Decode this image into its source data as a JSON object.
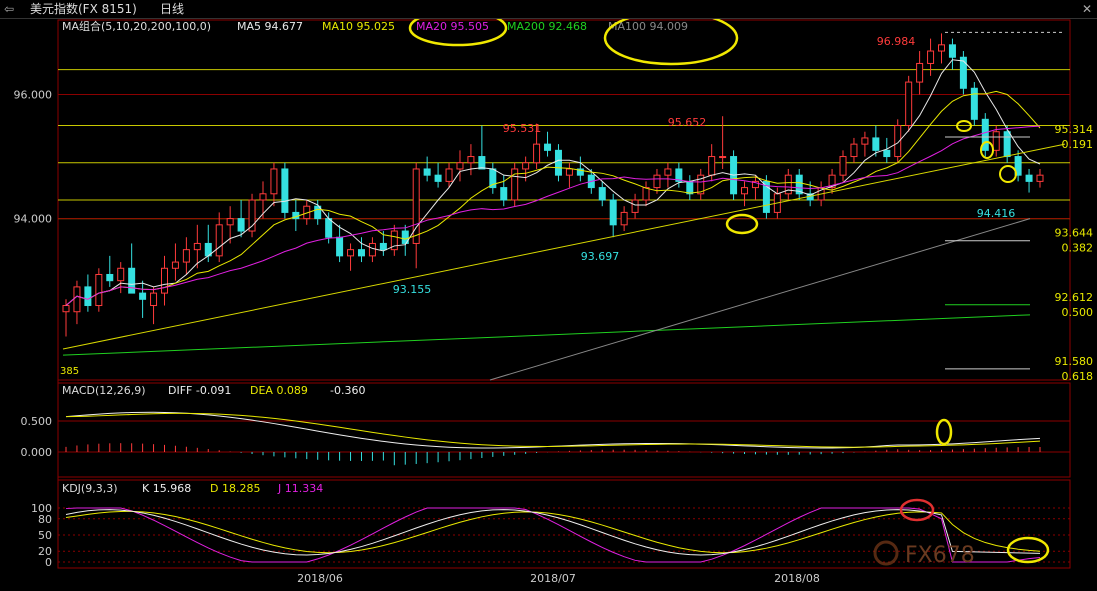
{
  "header": {
    "symbol_title": "美元指数(FX 8151)",
    "period": "日线"
  },
  "colors": {
    "up": "#ff3b3b",
    "down": "#35e0e0",
    "ma5": "#e8e8e8",
    "ma10": "#e8e800",
    "ma20": "#e020e0",
    "ma200": "#20d020",
    "ma100": "#888888",
    "grid": "#8b0000",
    "fib": "#e8e800"
  },
  "main_panel": {
    "legend": {
      "ma_group": "MA组合(5,10,20,200,100,0)",
      "ma5": "MA5 94.677",
      "ma10": "MA10 95.025",
      "ma20": "MA20 95.505",
      "ma200": "MA200 92.468",
      "ma100": "MA100 94.009"
    },
    "y_ticks": [
      "96.000",
      "94.000"
    ],
    "annotations": {
      "high": "96.984",
      "peak1": "95.531",
      "peak2": "95.652",
      "low1": "93.155",
      "low2": "93.697",
      "recent_low": "94.416",
      "corner_label": "385"
    },
    "fib_levels": [
      {
        "price": "95.314",
        "ratio": "0.191"
      },
      {
        "price": "93.644",
        "ratio": "0.382"
      },
      {
        "price": "92.612",
        "ratio": "0.500"
      },
      {
        "price": "91.580",
        "ratio": "0.618"
      }
    ]
  },
  "macd_panel": {
    "title": "MACD(12,26,9)",
    "diff": "DIFF -0.091",
    "dea": "DEA 0.089",
    "macd": "-0.360",
    "y_ticks": [
      "0.500",
      "0.000"
    ]
  },
  "kdj_panel": {
    "title": "KDJ(9,3,3)",
    "k": "K 15.968",
    "d": "D 18.285",
    "j": "J 11.334",
    "y_ticks": [
      "100",
      "80",
      "50",
      "20",
      "0"
    ]
  },
  "x_axis": [
    "2018/06",
    "2018/07",
    "2018/08"
  ],
  "watermark": "FX678",
  "chart_data": {
    "type": "candlestick",
    "ylim": [
      91.4,
      97.2
    ],
    "candles": [
      {
        "o": 92.5,
        "h": 92.7,
        "l": 92.1,
        "c": 92.6
      },
      {
        "o": 92.5,
        "h": 93.0,
        "l": 92.3,
        "c": 92.9
      },
      {
        "o": 92.9,
        "h": 93.1,
        "l": 92.5,
        "c": 92.6
      },
      {
        "o": 92.6,
        "h": 93.2,
        "l": 92.5,
        "c": 93.1
      },
      {
        "o": 93.1,
        "h": 93.4,
        "l": 92.9,
        "c": 93.0
      },
      {
        "o": 93.0,
        "h": 93.3,
        "l": 92.8,
        "c": 93.2
      },
      {
        "o": 93.2,
        "h": 93.6,
        "l": 92.9,
        "c": 92.8
      },
      {
        "o": 92.8,
        "h": 93.0,
        "l": 92.4,
        "c": 92.7
      },
      {
        "o": 92.6,
        "h": 92.9,
        "l": 92.3,
        "c": 92.8
      },
      {
        "o": 92.8,
        "h": 93.4,
        "l": 92.6,
        "c": 93.2
      },
      {
        "o": 93.2,
        "h": 93.6,
        "l": 93.0,
        "c": 93.3
      },
      {
        "o": 93.3,
        "h": 93.7,
        "l": 93.1,
        "c": 93.5
      },
      {
        "o": 93.5,
        "h": 93.9,
        "l": 93.2,
        "c": 93.6
      },
      {
        "o": 93.6,
        "h": 93.9,
        "l": 93.3,
        "c": 93.4
      },
      {
        "o": 93.4,
        "h": 94.1,
        "l": 93.3,
        "c": 93.9
      },
      {
        "o": 93.9,
        "h": 94.2,
        "l": 93.6,
        "c": 94.0
      },
      {
        "o": 94.0,
        "h": 94.3,
        "l": 93.7,
        "c": 93.8
      },
      {
        "o": 93.8,
        "h": 94.4,
        "l": 93.7,
        "c": 94.3
      },
      {
        "o": 94.3,
        "h": 94.6,
        "l": 94.0,
        "c": 94.4
      },
      {
        "o": 94.4,
        "h": 94.9,
        "l": 94.2,
        "c": 94.8
      },
      {
        "o": 94.8,
        "h": 94.9,
        "l": 94.0,
        "c": 94.1
      },
      {
        "o": 94.1,
        "h": 94.3,
        "l": 93.8,
        "c": 94.0
      },
      {
        "o": 94.0,
        "h": 94.3,
        "l": 93.9,
        "c": 94.2
      },
      {
        "o": 94.2,
        "h": 94.3,
        "l": 93.9,
        "c": 94.0
      },
      {
        "o": 94.0,
        "h": 94.1,
        "l": 93.6,
        "c": 93.7
      },
      {
        "o": 93.7,
        "h": 93.9,
        "l": 93.3,
        "c": 93.4
      },
      {
        "o": 93.4,
        "h": 93.6,
        "l": 93.16,
        "c": 93.5
      },
      {
        "o": 93.5,
        "h": 93.7,
        "l": 93.3,
        "c": 93.4
      },
      {
        "o": 93.4,
        "h": 93.7,
        "l": 93.3,
        "c": 93.6
      },
      {
        "o": 93.6,
        "h": 93.8,
        "l": 93.4,
        "c": 93.5
      },
      {
        "o": 93.5,
        "h": 93.9,
        "l": 93.4,
        "c": 93.8
      },
      {
        "o": 93.8,
        "h": 93.9,
        "l": 93.4,
        "c": 93.6
      },
      {
        "o": 93.6,
        "h": 94.9,
        "l": 93.2,
        "c": 94.8
      },
      {
        "o": 94.8,
        "h": 95.0,
        "l": 94.6,
        "c": 94.7
      },
      {
        "o": 94.7,
        "h": 94.9,
        "l": 94.5,
        "c": 94.6
      },
      {
        "o": 94.6,
        "h": 94.9,
        "l": 94.5,
        "c": 94.8
      },
      {
        "o": 94.8,
        "h": 95.1,
        "l": 94.6,
        "c": 94.9
      },
      {
        "o": 94.9,
        "h": 95.2,
        "l": 94.7,
        "c": 95.0
      },
      {
        "o": 95.0,
        "h": 95.5,
        "l": 94.8,
        "c": 94.8
      },
      {
        "o": 94.8,
        "h": 94.9,
        "l": 94.4,
        "c": 94.5
      },
      {
        "o": 94.5,
        "h": 94.7,
        "l": 94.2,
        "c": 94.3
      },
      {
        "o": 94.3,
        "h": 94.9,
        "l": 94.2,
        "c": 94.8
      },
      {
        "o": 94.8,
        "h": 95.0,
        "l": 94.6,
        "c": 94.9
      },
      {
        "o": 94.9,
        "h": 95.53,
        "l": 94.8,
        "c": 95.2
      },
      {
        "o": 95.2,
        "h": 95.4,
        "l": 95.0,
        "c": 95.1
      },
      {
        "o": 95.1,
        "h": 95.2,
        "l": 94.6,
        "c": 94.7
      },
      {
        "o": 94.7,
        "h": 94.9,
        "l": 94.5,
        "c": 94.8
      },
      {
        "o": 94.8,
        "h": 95.0,
        "l": 94.6,
        "c": 94.7
      },
      {
        "o": 94.7,
        "h": 94.8,
        "l": 94.4,
        "c": 94.5
      },
      {
        "o": 94.5,
        "h": 94.6,
        "l": 94.2,
        "c": 94.3
      },
      {
        "o": 94.3,
        "h": 94.4,
        "l": 93.7,
        "c": 93.9
      },
      {
        "o": 93.9,
        "h": 94.2,
        "l": 93.8,
        "c": 94.1
      },
      {
        "o": 94.1,
        "h": 94.4,
        "l": 94.0,
        "c": 94.3
      },
      {
        "o": 94.3,
        "h": 94.6,
        "l": 94.2,
        "c": 94.5
      },
      {
        "o": 94.5,
        "h": 94.8,
        "l": 94.4,
        "c": 94.7
      },
      {
        "o": 94.7,
        "h": 94.9,
        "l": 94.5,
        "c": 94.8
      },
      {
        "o": 94.8,
        "h": 94.9,
        "l": 94.5,
        "c": 94.6
      },
      {
        "o": 94.6,
        "h": 94.7,
        "l": 94.3,
        "c": 94.4
      },
      {
        "o": 94.4,
        "h": 94.8,
        "l": 94.3,
        "c": 94.7
      },
      {
        "o": 94.7,
        "h": 95.2,
        "l": 94.6,
        "c": 95.0
      },
      {
        "o": 95.0,
        "h": 95.65,
        "l": 94.8,
        "c": 95.0
      },
      {
        "o": 95.0,
        "h": 95.1,
        "l": 94.3,
        "c": 94.4
      },
      {
        "o": 94.4,
        "h": 94.6,
        "l": 94.2,
        "c": 94.5
      },
      {
        "o": 94.5,
        "h": 94.7,
        "l": 94.3,
        "c": 94.6
      },
      {
        "o": 94.6,
        "h": 94.7,
        "l": 94.0,
        "c": 94.1
      },
      {
        "o": 94.1,
        "h": 94.5,
        "l": 94.0,
        "c": 94.4
      },
      {
        "o": 94.4,
        "h": 94.8,
        "l": 94.3,
        "c": 94.7
      },
      {
        "o": 94.7,
        "h": 94.8,
        "l": 94.3,
        "c": 94.4
      },
      {
        "o": 94.4,
        "h": 94.6,
        "l": 94.2,
        "c": 94.3
      },
      {
        "o": 94.3,
        "h": 94.6,
        "l": 94.2,
        "c": 94.5
      },
      {
        "o": 94.5,
        "h": 94.8,
        "l": 94.4,
        "c": 94.7
      },
      {
        "o": 94.7,
        "h": 95.1,
        "l": 94.6,
        "c": 95.0
      },
      {
        "o": 95.0,
        "h": 95.3,
        "l": 94.9,
        "c": 95.2
      },
      {
        "o": 95.2,
        "h": 95.4,
        "l": 95.0,
        "c": 95.3
      },
      {
        "o": 95.3,
        "h": 95.5,
        "l": 95.0,
        "c": 95.1
      },
      {
        "o": 95.1,
        "h": 95.3,
        "l": 94.9,
        "c": 95.0
      },
      {
        "o": 95.0,
        "h": 95.6,
        "l": 94.9,
        "c": 95.5
      },
      {
        "o": 95.5,
        "h": 96.3,
        "l": 95.4,
        "c": 96.2
      },
      {
        "o": 96.2,
        "h": 96.7,
        "l": 96.0,
        "c": 96.5
      },
      {
        "o": 96.5,
        "h": 96.9,
        "l": 96.3,
        "c": 96.7
      },
      {
        "o": 96.7,
        "h": 96.984,
        "l": 96.5,
        "c": 96.8
      },
      {
        "o": 96.8,
        "h": 96.9,
        "l": 96.4,
        "c": 96.6
      },
      {
        "o": 96.6,
        "h": 96.7,
        "l": 96.0,
        "c": 96.1
      },
      {
        "o": 96.1,
        "h": 96.2,
        "l": 95.5,
        "c": 95.6
      },
      {
        "o": 95.6,
        "h": 95.7,
        "l": 95.0,
        "c": 95.1
      },
      {
        "o": 95.1,
        "h": 95.5,
        "l": 95.0,
        "c": 95.4
      },
      {
        "o": 95.4,
        "h": 95.5,
        "l": 94.9,
        "c": 95.0
      },
      {
        "o": 95.0,
        "h": 95.1,
        "l": 94.6,
        "c": 94.7
      },
      {
        "o": 94.7,
        "h": 94.8,
        "l": 94.42,
        "c": 94.6
      },
      {
        "o": 94.6,
        "h": 94.8,
        "l": 94.5,
        "c": 94.7
      }
    ]
  }
}
